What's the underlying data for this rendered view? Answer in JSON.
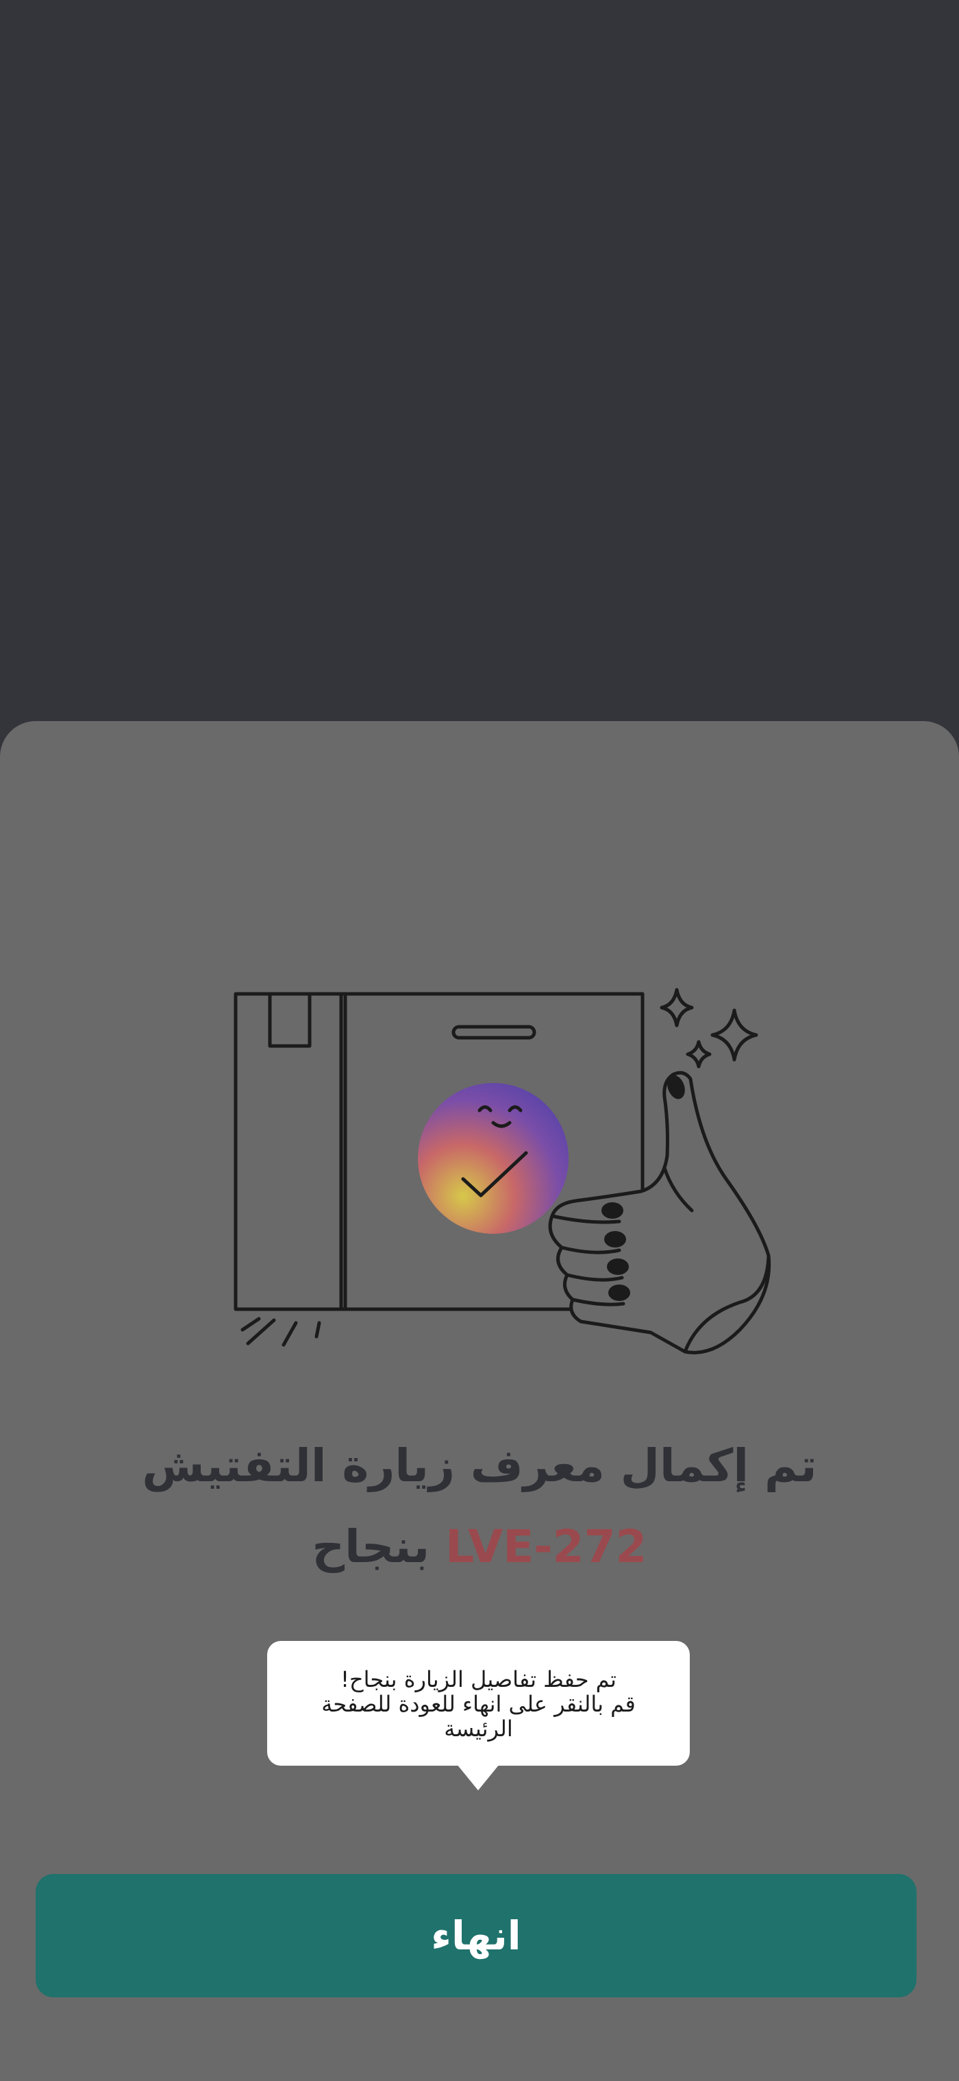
{
  "colors": {
    "backdrop": "#34353b",
    "sheet": "#6a6a6a",
    "title_text": "#303137",
    "visit_id_accent": "#9a4a4e",
    "tooltip_bg": "#ffffff",
    "primary_button": "#20726c",
    "primary_button_text": "#ffffff"
  },
  "success_sheet": {
    "illustration_icon": "box-thumbs-up-check-icon",
    "title_part1": "تم إكمال معرف زيارة التفتيش",
    "visit_id": "LVE-272",
    "title_part2": "بنجاح",
    "tooltip": {
      "line1": "تم حفظ تفاصيل الزيارة بنجاح!",
      "line2": "قم بالنقر على انهاء للعودة للصفحة",
      "line3": "الرئيسة"
    },
    "finish_button_label": "انهاء"
  }
}
